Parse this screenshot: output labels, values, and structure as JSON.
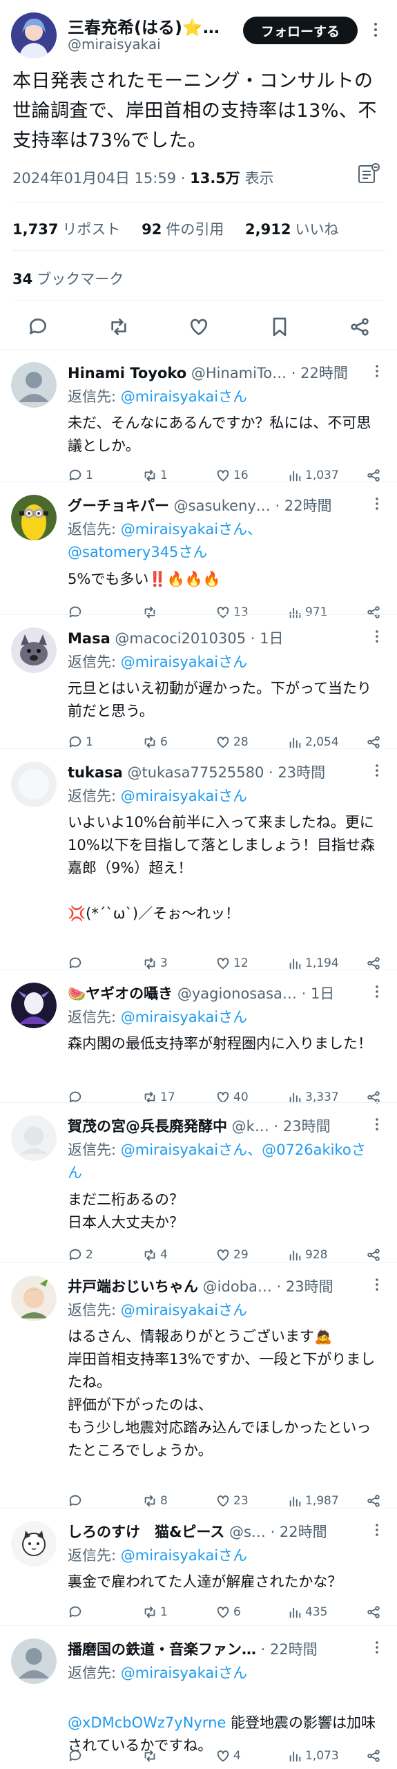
{
  "main": {
    "author_name": "三春充希(はる)⭐…",
    "author_handle": "@miraisyakai",
    "follow_label": "フォローする",
    "text": "本日発表されたモーニング・コンサルトの世論調査で、岸田首相の支持率は13%、不支持率は73%でした。",
    "timestamp": "2024年01月04日 15:59 · ",
    "views_count": "13.5万",
    "views_label": " 表示",
    "reposts_count": "1,737",
    "reposts_label": "リポスト",
    "quotes_count": "92",
    "quotes_label": "件の引用",
    "likes_count": "2,912",
    "likes_label": "いいね",
    "bookmarks_count": "34",
    "bookmarks_label": "ブックマーク"
  },
  "replies": [
    {
      "name": "Hinami Toyoko",
      "handle": " @HinamiTo…",
      "time": " · 22時間",
      "replyto_prefix": "返信先: ",
      "replyto_links": "@miraisyakaiさん",
      "body": "未だ、そんなにあるんですか？私には、不可思議としか。",
      "replies": "1",
      "reposts": "1",
      "likes": "16",
      "views": "1,037"
    },
    {
      "name": "グーチョキパー",
      "handle": " @sasukeny…",
      "time": " · 22時間",
      "replyto_prefix": "返信先: ",
      "replyto_links": "@miraisyakaiさん、\n@satomery345さん",
      "body": "5%でも多い‼️🔥🔥🔥",
      "replies": "",
      "reposts": "",
      "likes": "13",
      "views": "971"
    },
    {
      "name": "Masa",
      "handle": " @macoci2010305",
      "time": " · 1日",
      "replyto_prefix": "返信先: ",
      "replyto_links": "@miraisyakaiさん",
      "body": "元旦とはいえ初動が遅かった。下がって当たり前だと思う。",
      "replies": "1",
      "reposts": "6",
      "likes": "28",
      "views": "2,054"
    },
    {
      "name": "tukasa",
      "handle": " @tukasa77525580",
      "time": " · 23時間",
      "replyto_prefix": "返信先: ",
      "replyto_links": "@miraisyakaiさん",
      "body": "いよいよ10%台前半に入って来ましたね。更に10%以下を目指して落としましょう！目指せ森嘉郎（9%）超え！\n\n💢(*ˊ`ω`)／そぉ～れッ！",
      "replies": "",
      "reposts": "3",
      "likes": "12",
      "views": "1,194"
    },
    {
      "name": "🍉ヤギオの囁き",
      "handle": " @yagionosasa…",
      "time": " · 1日",
      "replyto_prefix": "返信先: ",
      "replyto_links": "@miraisyakaiさん",
      "body": "森内閣の最低支持率が射程圏内に入りました！",
      "replies": "",
      "reposts": "17",
      "likes": "40",
      "views": "3,337"
    },
    {
      "name": "賀茂の宮@兵長廃発酵中",
      "handle": " @k…",
      "time": " · 23時間",
      "replyto_prefix": "返信先: ",
      "replyto_links": "@miraisyakaiさん、@0726akikoさん",
      "body": "まだ二桁あるの？\n日本人大丈夫か？",
      "replies": "2",
      "reposts": "4",
      "likes": "29",
      "views": "928"
    },
    {
      "name": "井戸端おじいちゃん",
      "handle": " @idoba…",
      "time": " · 23時間",
      "replyto_prefix": "返信先: ",
      "replyto_links": "@miraisyakaiさん",
      "body": "はるさん、情報ありがとうございます🙇\n岸田首相支持率13%ですか、一段と下がりましたね。\n評価が下がったのは、\nもう少し地震対応踏み込んでほしかったといったところでしょうか。",
      "replies": "",
      "reposts": "8",
      "likes": "23",
      "views": "1,987"
    },
    {
      "name": "しろのすけ　猫&ピース",
      "handle": " @s…",
      "time": " · 22時間",
      "replyto_prefix": "返信先: ",
      "replyto_links": "@miraisyakaiさん",
      "body": "裏金で雇われてた人達が解雇されたかな？",
      "replies": "",
      "reposts": "1",
      "likes": "6",
      "views": "435"
    },
    {
      "name": "播磨国の鉄道・音楽ファン…",
      "handle": "",
      "time": " · 22時間",
      "replyto_prefix": "返信先: ",
      "replyto_links": "@miraisyakaiさん",
      "body_link": "@xDMcbOWz7yNyrne",
      "body": " 能登地震の影響は加味されているかですね。",
      "replies": "",
      "reposts": "",
      "likes": "4",
      "views": "1,073"
    }
  ]
}
